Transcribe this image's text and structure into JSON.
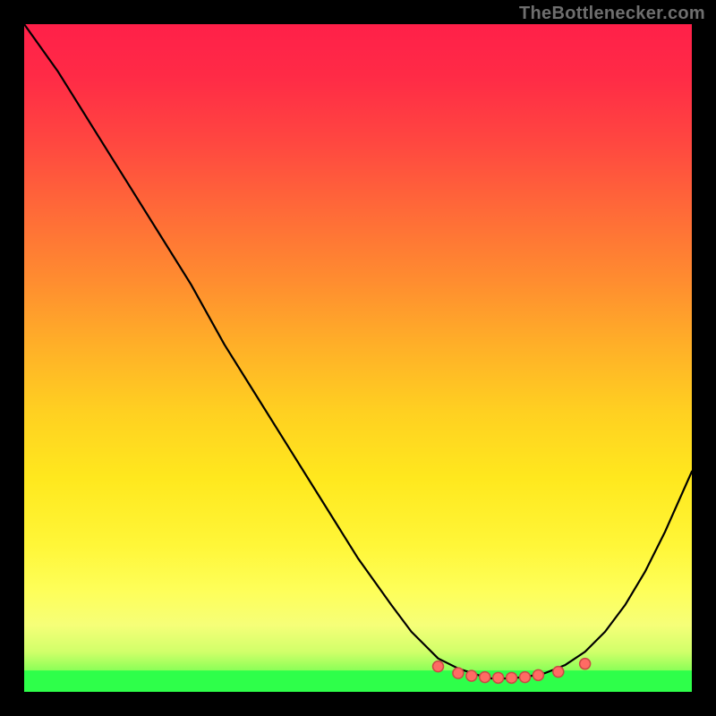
{
  "watermark": "TheBottlenecker.com",
  "chart_data": {
    "type": "line",
    "title": "",
    "xlabel": "",
    "ylabel": "",
    "xlim": [
      0,
      100
    ],
    "ylim": [
      0,
      100
    ],
    "x": [
      0,
      5,
      10,
      15,
      20,
      25,
      30,
      35,
      40,
      45,
      50,
      55,
      58,
      60,
      62,
      65,
      68,
      70,
      72,
      75,
      78,
      81,
      84,
      87,
      90,
      93,
      96,
      100
    ],
    "y": [
      100,
      93,
      85,
      77,
      69,
      61,
      52,
      44,
      36,
      28,
      20,
      13,
      9,
      7,
      5,
      3.5,
      2.5,
      2,
      2,
      2.2,
      2.8,
      4,
      6,
      9,
      13,
      18,
      24,
      33
    ],
    "band": {
      "color": "#2eff4a",
      "ymin": 0,
      "ymax": 3.2
    },
    "gradient_stops": [
      {
        "offset": 0.0,
        "color": "#ff2049"
      },
      {
        "offset": 0.08,
        "color": "#ff2b46"
      },
      {
        "offset": 0.18,
        "color": "#ff4840"
      },
      {
        "offset": 0.28,
        "color": "#ff6a38"
      },
      {
        "offset": 0.38,
        "color": "#ff8b30"
      },
      {
        "offset": 0.48,
        "color": "#ffaf28"
      },
      {
        "offset": 0.58,
        "color": "#ffd021"
      },
      {
        "offset": 0.68,
        "color": "#ffe81e"
      },
      {
        "offset": 0.78,
        "color": "#fff638"
      },
      {
        "offset": 0.85,
        "color": "#feff5a"
      },
      {
        "offset": 0.9,
        "color": "#f6ff78"
      },
      {
        "offset": 0.94,
        "color": "#d1ff6a"
      },
      {
        "offset": 0.97,
        "color": "#86ff56"
      },
      {
        "offset": 1.0,
        "color": "#2eff4a"
      }
    ],
    "markers": {
      "cluster_x": [
        62,
        65,
        67,
        69,
        71,
        73,
        75,
        77,
        80,
        84
      ],
      "cluster_y": [
        3.8,
        2.8,
        2.4,
        2.2,
        2.1,
        2.1,
        2.2,
        2.5,
        3.0,
        4.2
      ],
      "radius": 6,
      "fill": "#ff6b64",
      "stroke": "#c94a44"
    }
  }
}
